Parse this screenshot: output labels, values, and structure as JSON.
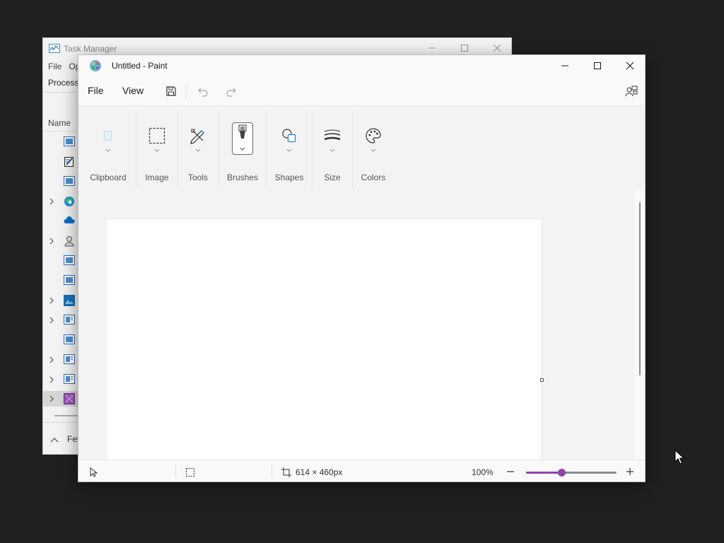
{
  "task_manager": {
    "title": "Task Manager",
    "menu": [
      "File",
      "Op"
    ],
    "tab": "Processe",
    "column": "Name",
    "footer": "Fev"
  },
  "paint": {
    "title": "Untitled - Paint",
    "menu": {
      "file": "File",
      "view": "View"
    },
    "ribbon": {
      "clipboard": "Clipboard",
      "image": "Image",
      "tools": "Tools",
      "brushes": "Brushes",
      "shapes": "Shapes",
      "size": "Size",
      "colors": "Colors"
    },
    "status": {
      "canvas_size": "614 × 460px",
      "zoom_label": "100%",
      "zoom_fraction": 0.39
    },
    "colors": {
      "accent": "#8e44ad"
    }
  }
}
